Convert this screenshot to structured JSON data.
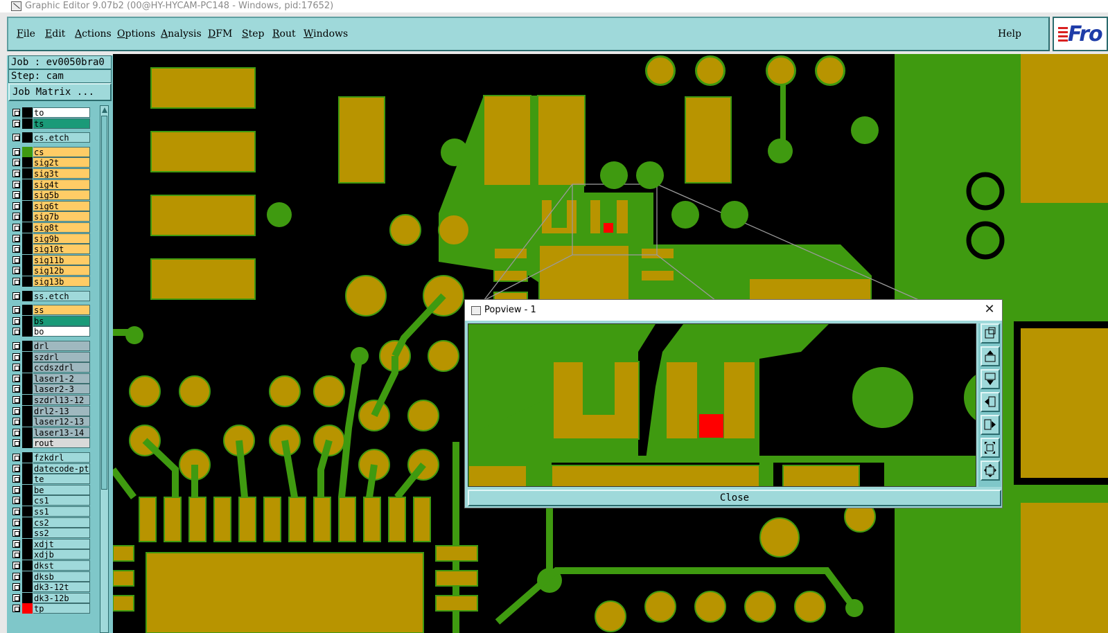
{
  "window": {
    "title": "Graphic Editor 9.07b2 (00@HY-HYCAM-PC148 - Windows, pid:17652)"
  },
  "menu": {
    "items": [
      "File",
      "Edit",
      "Actions",
      "Options",
      "Analysis",
      "DFM",
      "Step",
      "Rout",
      "Windows"
    ],
    "help": "Help",
    "brand": "Fro"
  },
  "job": {
    "job_label": "Job : ev0050bra0",
    "step_label": "Step: cam",
    "matrix_button": "Job Matrix ..."
  },
  "layers": [
    {
      "name": "to",
      "color": "#ffffff",
      "swatch": "#000000"
    },
    {
      "name": "ts",
      "color": "#1a9a78",
      "swatch": "#000000"
    },
    {
      "name": "cs.etch",
      "color": "#9fd9da",
      "swatch": "#000000"
    },
    {
      "name": "cs",
      "color": "#ffcc66",
      "swatch": "#3f9a10"
    },
    {
      "name": "sig2t",
      "color": "#ffcc66",
      "swatch": "#000000"
    },
    {
      "name": "sig3t",
      "color": "#ffcc66",
      "swatch": "#000000"
    },
    {
      "name": "sig4t",
      "color": "#ffcc66",
      "swatch": "#000000"
    },
    {
      "name": "sig5b",
      "color": "#ffcc66",
      "swatch": "#000000"
    },
    {
      "name": "sig6t",
      "color": "#ffcc66",
      "swatch": "#000000"
    },
    {
      "name": "sig7b",
      "color": "#ffcc66",
      "swatch": "#000000"
    },
    {
      "name": "sig8t",
      "color": "#ffcc66",
      "swatch": "#000000"
    },
    {
      "name": "sig9b",
      "color": "#ffcc66",
      "swatch": "#000000"
    },
    {
      "name": "sig10t",
      "color": "#ffcc66",
      "swatch": "#000000"
    },
    {
      "name": "sig11b",
      "color": "#ffcc66",
      "swatch": "#000000"
    },
    {
      "name": "sig12b",
      "color": "#ffcc66",
      "swatch": "#000000"
    },
    {
      "name": "sig13b",
      "color": "#ffcc66",
      "swatch": "#000000"
    },
    {
      "name": "ss.etch",
      "color": "#9fd9da",
      "swatch": "#000000"
    },
    {
      "name": "ss",
      "color": "#ffcc66",
      "swatch": "#000000"
    },
    {
      "name": "bs",
      "color": "#1a9a78",
      "swatch": "#000000"
    },
    {
      "name": "bo",
      "color": "#ffffff",
      "swatch": "#000000"
    },
    {
      "name": "drl",
      "color": "#9fb8bf",
      "swatch": "#000000"
    },
    {
      "name": "szdrl",
      "color": "#9fb8bf",
      "swatch": "#000000"
    },
    {
      "name": "ccdszdrl",
      "color": "#9fb8bf",
      "swatch": "#000000"
    },
    {
      "name": "laser1-2",
      "color": "#9fb8bf",
      "swatch": "#000000"
    },
    {
      "name": "laser2-3",
      "color": "#9fb8bf",
      "swatch": "#000000"
    },
    {
      "name": "szdrl13-12",
      "color": "#9fb8bf",
      "swatch": "#000000"
    },
    {
      "name": "drl2-13",
      "color": "#9fb8bf",
      "swatch": "#000000"
    },
    {
      "name": "laser12-13",
      "color": "#9fb8bf",
      "swatch": "#000000"
    },
    {
      "name": "laser13-14",
      "color": "#9fb8bf",
      "swatch": "#000000"
    },
    {
      "name": "rout",
      "color": "#d9d9d9",
      "swatch": "#000000"
    },
    {
      "name": "fzkdrl",
      "color": "#9fd9da",
      "swatch": "#000000"
    },
    {
      "name": "datecode-ptc",
      "color": "#9fd9da",
      "swatch": "#000000"
    },
    {
      "name": "te",
      "color": "#9fd9da",
      "swatch": "#000000"
    },
    {
      "name": "be",
      "color": "#9fd9da",
      "swatch": "#000000"
    },
    {
      "name": "cs1",
      "color": "#9fd9da",
      "swatch": "#000000"
    },
    {
      "name": "ss1",
      "color": "#9fd9da",
      "swatch": "#000000"
    },
    {
      "name": "cs2",
      "color": "#9fd9da",
      "swatch": "#000000"
    },
    {
      "name": "ss2",
      "color": "#9fd9da",
      "swatch": "#000000"
    },
    {
      "name": "xdjt",
      "color": "#9fd9da",
      "swatch": "#000000"
    },
    {
      "name": "xdjb",
      "color": "#9fd9da",
      "swatch": "#000000"
    },
    {
      "name": "dkst",
      "color": "#9fd9da",
      "swatch": "#000000"
    },
    {
      "name": "dksb",
      "color": "#9fd9da",
      "swatch": "#000000"
    },
    {
      "name": "dk3-12t",
      "color": "#9fd9da",
      "swatch": "#000000"
    },
    {
      "name": "dk3-12b",
      "color": "#9fd9da",
      "swatch": "#000000"
    },
    {
      "name": "tp",
      "color": "#9fd9da",
      "swatch": "#ff0000"
    }
  ],
  "popview": {
    "title": "Popview - 1",
    "close_x": "✕",
    "close_button": "Close",
    "tools": [
      "zoom-home-icon",
      "pan-up-icon",
      "pan-down-icon",
      "pan-left-icon",
      "pan-right-icon",
      "zoom-in-icon",
      "zoom-out-icon"
    ]
  },
  "colors": {
    "copper": "#b89400",
    "copper_edge": "#3f9a10",
    "plane": "#3f9a10",
    "highlight": "#ff0000",
    "panel": "#9fd9da"
  }
}
